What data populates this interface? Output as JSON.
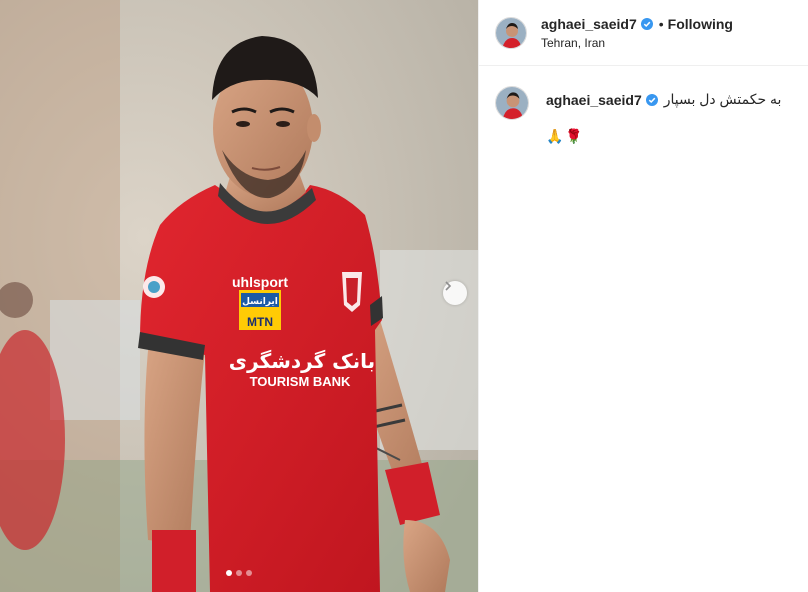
{
  "post": {
    "username": "aghaei_saeid7",
    "follow_status": "Following",
    "location": "Tehran, Iran",
    "caption": "به حکمتش دل بسپار",
    "caption_emoji": "🙏🌹",
    "separator": "•"
  },
  "image": {
    "carousel_total": 3,
    "carousel_current": 1,
    "jersey_sponsor_line1": "بانک گردشگری",
    "jersey_sponsor_line2": "TOURISM BANK",
    "jersey_brand": "uhlsport",
    "jersey_patch": "MTN",
    "jersey_patch_fa": "ایرانسل"
  },
  "colors": {
    "verified_blue": "#3897f0",
    "jersey_red": "#d4202a",
    "text": "#262626"
  },
  "icons": {
    "verified": "verified-badge-icon",
    "next": "chevron-right-icon"
  }
}
